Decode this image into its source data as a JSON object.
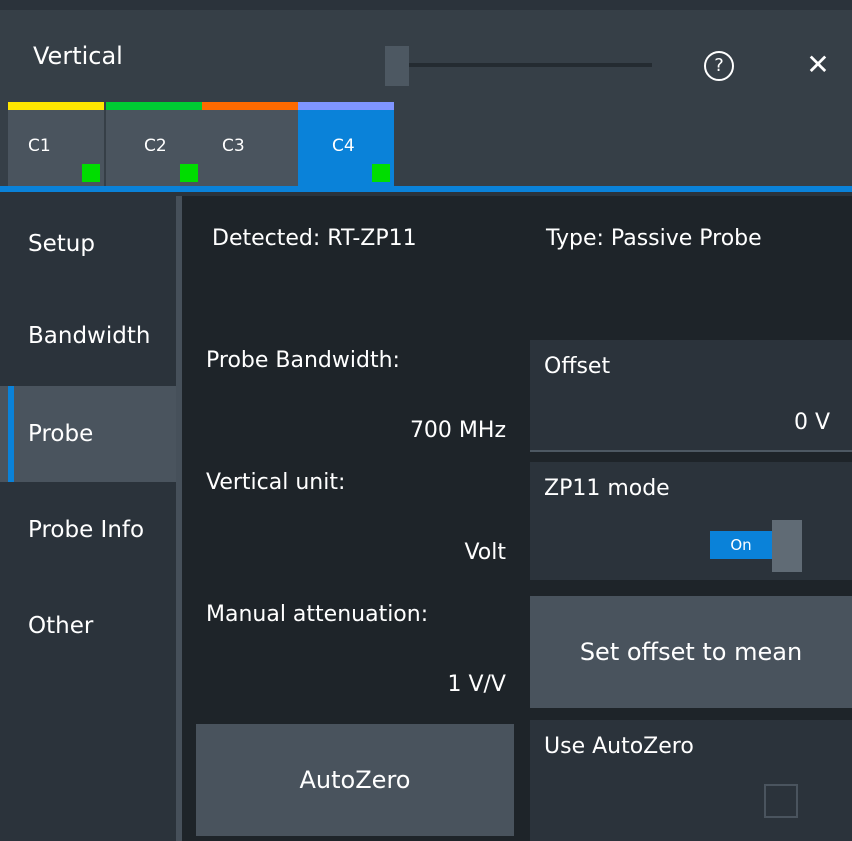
{
  "window": {
    "title": "Vertical",
    "help_icon": "question-circle-icon",
    "help_glyph": "?",
    "close_icon": "close-icon",
    "close_glyph": "✕"
  },
  "tabs": [
    {
      "label": "C1",
      "color": "#ffe600"
    },
    {
      "label": "C2",
      "color": "#00cc33"
    },
    {
      "label": "C3",
      "color": "#ff6a00"
    },
    {
      "label": "C4",
      "color": "#7f95ff",
      "active": true
    }
  ],
  "sidebar": {
    "items": [
      {
        "label": "Setup"
      },
      {
        "label": "Bandwidth"
      },
      {
        "label": "Probe",
        "active": true
      },
      {
        "label": "Probe Info"
      },
      {
        "label": "Other"
      }
    ]
  },
  "probe": {
    "detected": "Detected:  RT-ZP11",
    "type": "Type:  Passive Probe",
    "bandwidth_label": "Probe Bandwidth:",
    "bandwidth_value": "700 MHz",
    "unit_label": "Vertical unit:",
    "unit_value": "Volt",
    "attenuation_label": "Manual attenuation:",
    "attenuation_value": "1 V/V",
    "offset_label": "Offset",
    "offset_value": "0  V",
    "zp11_label": "ZP11 mode",
    "zp11_toggle": "On",
    "set_offset_button": "Set offset to mean",
    "autozero_button": "AutoZero",
    "use_autozero_label": "Use AutoZero",
    "use_autozero_checked": false
  },
  "colors": {
    "accent": "#0a82d9",
    "indicator": "#00dd00",
    "background": "#2b333b",
    "content_bg": "#1e2429"
  }
}
